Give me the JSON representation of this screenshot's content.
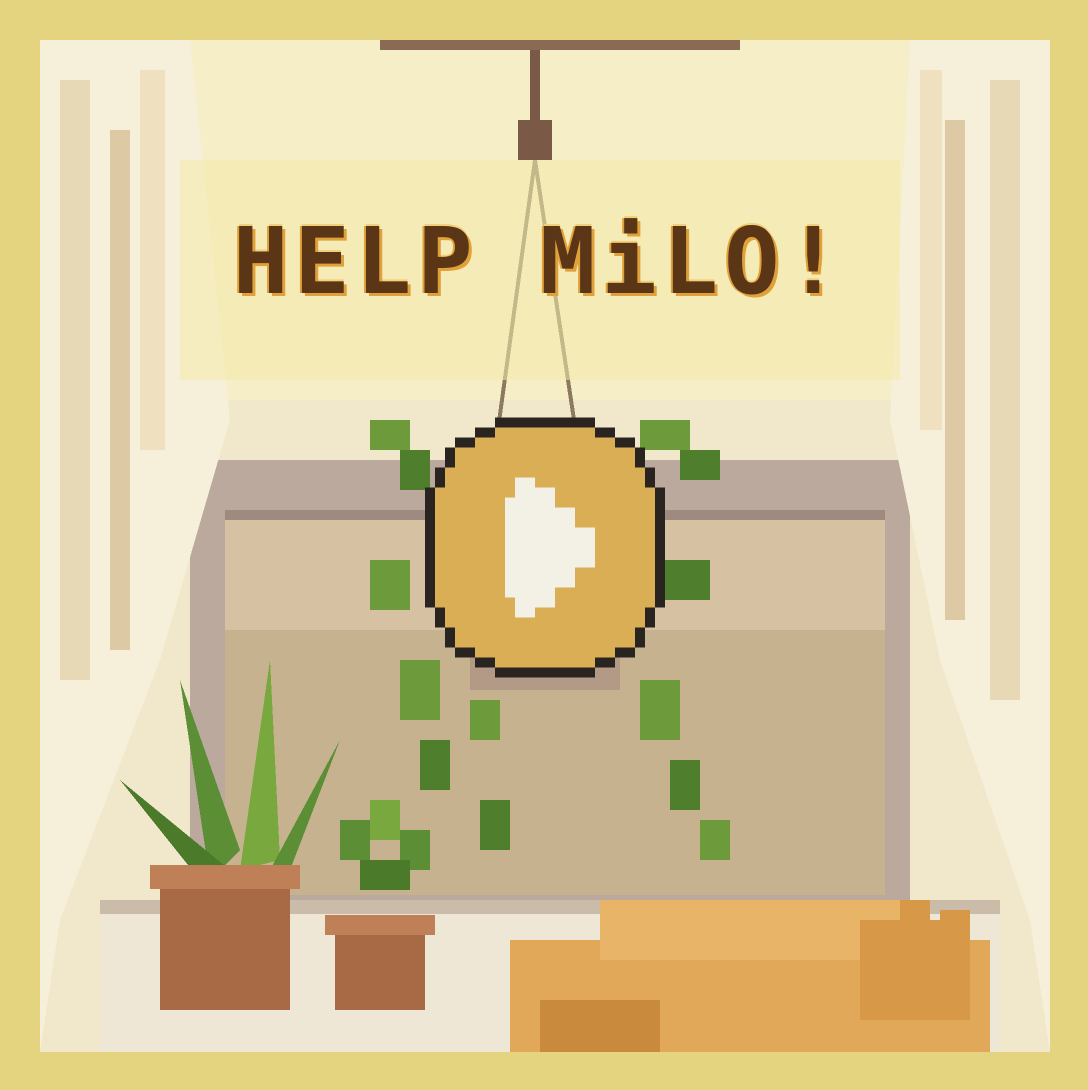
{
  "game": {
    "title": "HELP MiLO!",
    "play_button_icon": "play-icon"
  },
  "colors": {
    "page_border": "#e5d47f",
    "title_text": "#5a3516",
    "title_outline": "#e0a03a",
    "play_button_fill": "#d9ae54",
    "play_button_outline": "#2a2420",
    "play_icon": "#f3f0e6"
  }
}
